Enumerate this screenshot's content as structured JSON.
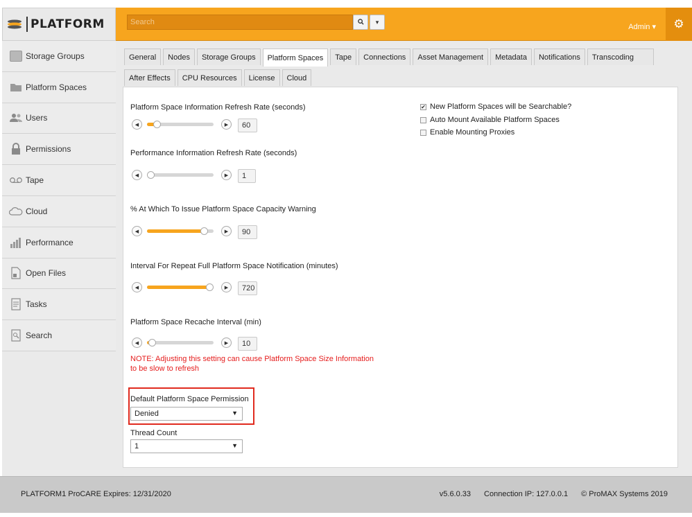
{
  "brand": {
    "name": "PLATFORM"
  },
  "header": {
    "search_placeholder": "Search",
    "search_icon": "magnifier-icon",
    "dropdown_caret": "▾",
    "admin_label": "Admin",
    "admin_caret": "▾",
    "gear_icon": "gear-icon"
  },
  "sidebar": {
    "items": [
      {
        "label": "Storage Groups",
        "icon": "storage-groups-icon"
      },
      {
        "label": "Platform Spaces",
        "icon": "folder-icon"
      },
      {
        "label": "Users",
        "icon": "users-icon"
      },
      {
        "label": "Permissions",
        "icon": "lock-icon"
      },
      {
        "label": "Tape",
        "icon": "tape-icon"
      },
      {
        "label": "Cloud",
        "icon": "cloud-icon"
      },
      {
        "label": "Performance",
        "icon": "bar-graph-icon"
      },
      {
        "label": "Open Files",
        "icon": "file-lock-icon"
      },
      {
        "label": "Tasks",
        "icon": "tasks-icon"
      },
      {
        "label": "Search",
        "icon": "search-doc-icon"
      }
    ]
  },
  "tabs": {
    "row1": [
      "General",
      "Nodes",
      "Storage Groups",
      "Platform Spaces",
      "Tape",
      "Connections",
      "Asset Management",
      "Metadata",
      "Notifications",
      "Transcoding"
    ],
    "row2": [
      "After Effects",
      "CPU Resources",
      "License",
      "Cloud"
    ],
    "active": "Platform Spaces"
  },
  "settings": {
    "refresh_rate": {
      "label": "Platform Space Information Refresh Rate (seconds)",
      "value": "60",
      "level": 0.1
    },
    "perf_refresh": {
      "label": "Performance Information Refresh Rate (seconds)",
      "value": "1",
      "level": 0.0
    },
    "capacity_warning": {
      "label": "% At Which To Issue Platform Space Capacity Warning",
      "value": "90",
      "level": 0.9
    },
    "repeat_notification": {
      "label": "Interval For Repeat Full Platform Space Notification (minutes)",
      "value": "720",
      "level": 1.0
    },
    "recache_interval": {
      "label": "Platform Space Recache Interval (min)",
      "value": "10",
      "level": 0.02
    },
    "note": "NOTE: Adjusting this setting can cause Platform Space Size Information to be slow to refresh",
    "default_permission": {
      "label": "Default Platform Space Permission",
      "value": "Denied"
    },
    "thread_count": {
      "label": "Thread Count",
      "value": "1"
    },
    "checkboxes": [
      {
        "label": "New Platform Spaces will be Searchable?",
        "checked": true
      },
      {
        "label": "Auto Mount Available Platform Spaces",
        "checked": false
      },
      {
        "label": "Enable Mounting Proxies",
        "checked": false
      }
    ]
  },
  "footer": {
    "expiry": "PLATFORM1 ProCARE Expires: 12/31/2020",
    "version": "v5.6.0.33",
    "connection": "Connection IP: 127.0.0.1",
    "copyright": "© ProMAX Systems 2019"
  },
  "colors": {
    "accent": "#f7a51e",
    "warning": "#e51c1c",
    "highlight": "#e02a1e"
  }
}
